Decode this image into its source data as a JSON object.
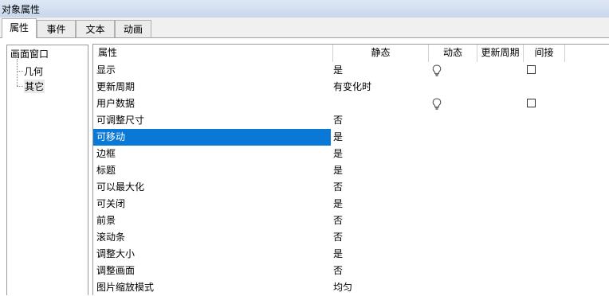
{
  "window": {
    "title": "对象属性"
  },
  "tabs": [
    {
      "label": "属性"
    },
    {
      "label": "事件"
    },
    {
      "label": "文本"
    },
    {
      "label": "动画"
    }
  ],
  "tree": {
    "root": "画面窗口",
    "children": [
      {
        "label": "几何"
      },
      {
        "label": "其它"
      }
    ]
  },
  "columns": {
    "property": "属性",
    "static": "静态",
    "dynamic": "动态",
    "update": "更新周期",
    "indirect": "间接"
  },
  "rows": [
    {
      "name": "显示",
      "static": "是",
      "dynamic_icon": "lightbulb-icon",
      "indirect_checked": false
    },
    {
      "name": "更新周期",
      "static": "有变化时"
    },
    {
      "name": "用户数据",
      "static": "",
      "dynamic_icon": "lightbulb-icon",
      "indirect_checked": false
    },
    {
      "name": "可调整尺寸",
      "static": "否"
    },
    {
      "name": "可移动",
      "static": "是",
      "selected": true
    },
    {
      "name": "边框",
      "static": "是"
    },
    {
      "name": "标题",
      "static": "是"
    },
    {
      "name": "可以最大化",
      "static": "否"
    },
    {
      "name": "可关闭",
      "static": "是"
    },
    {
      "name": "前景",
      "static": "否"
    },
    {
      "name": "滚动条",
      "static": "否"
    },
    {
      "name": "调整大小",
      "static": "是"
    },
    {
      "name": "调整画面",
      "static": "否"
    },
    {
      "name": "图片缩放模式",
      "static": "均匀"
    }
  ],
  "colors": {
    "selection": "#0a78d7",
    "titlebar": "#c8d7ec"
  }
}
